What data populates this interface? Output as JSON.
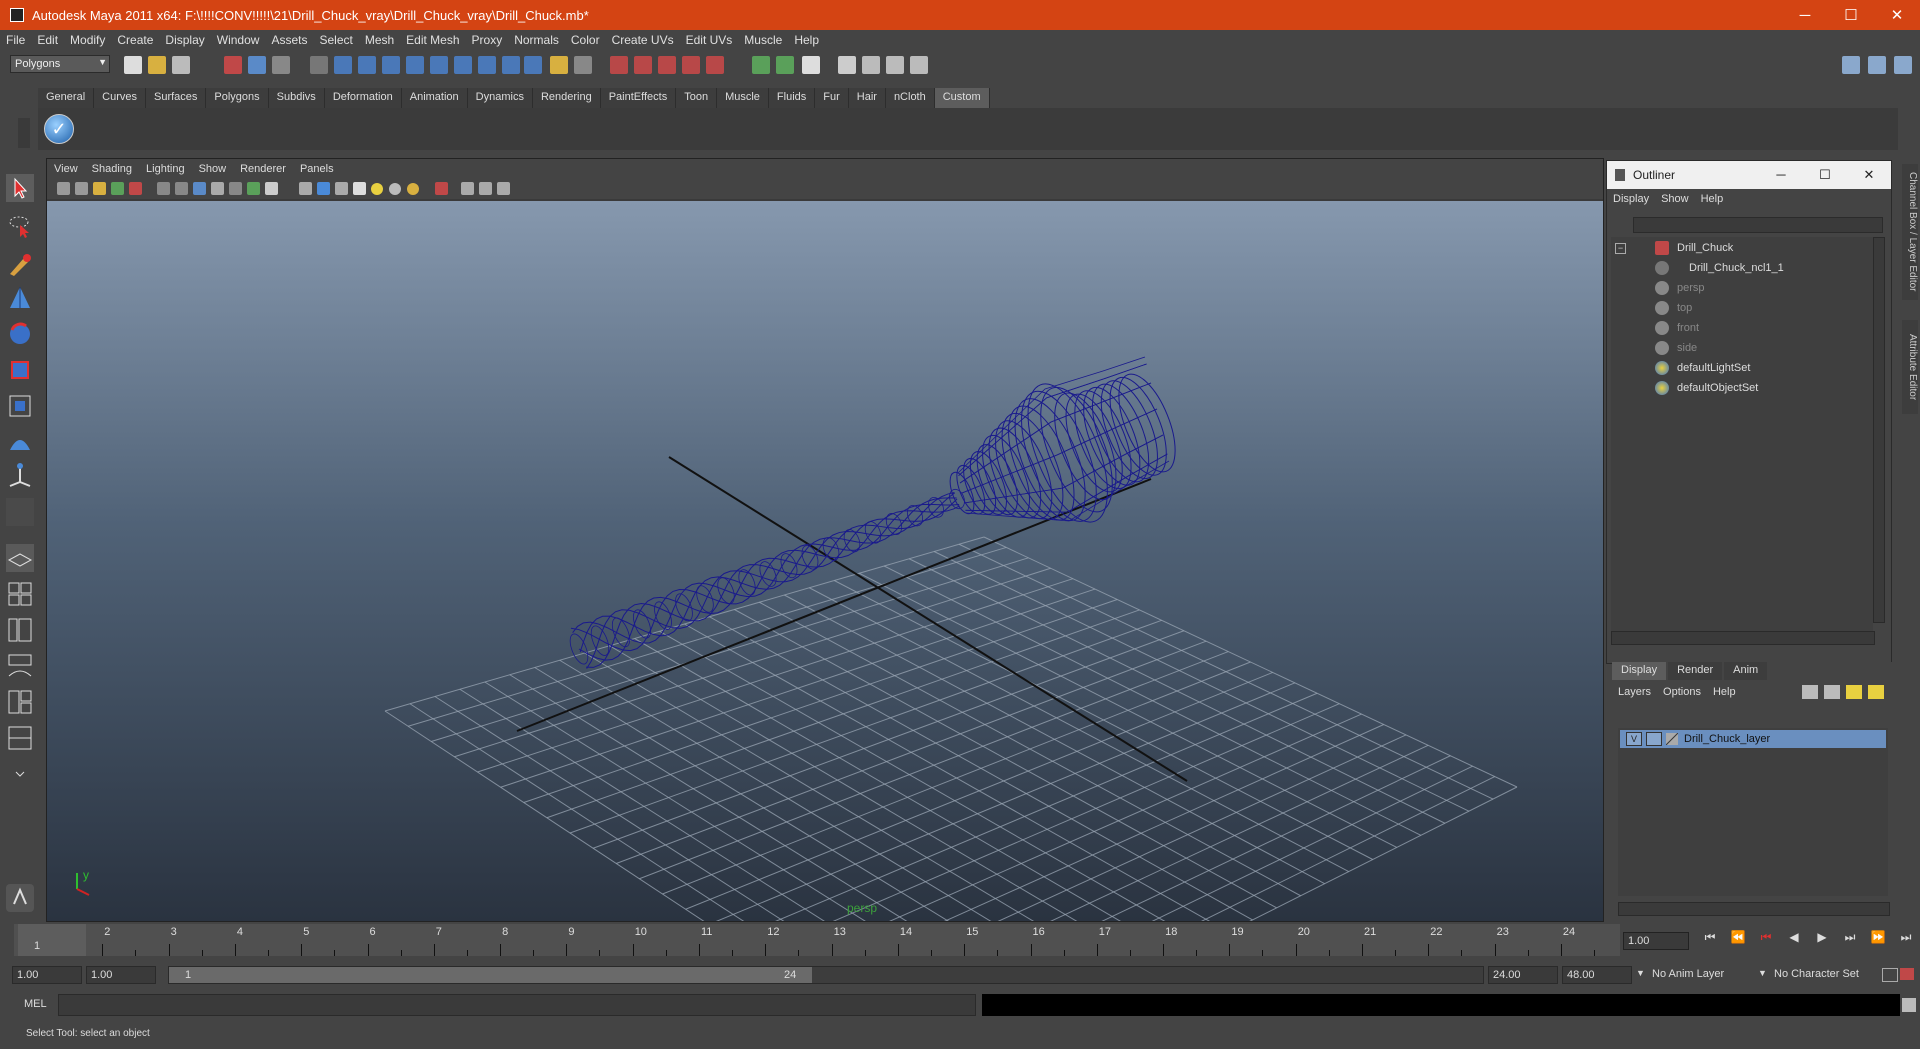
{
  "window": {
    "title": "Autodesk Maya 2011 x64: F:\\!!!!CONV!!!!!\\21\\Drill_Chuck_vray\\Drill_Chuck_vray\\Drill_Chuck.mb*",
    "minimize": "─",
    "maximize": "☐",
    "close": "✕"
  },
  "menubar": [
    "File",
    "Edit",
    "Modify",
    "Create",
    "Display",
    "Window",
    "Assets",
    "Select",
    "Mesh",
    "Edit Mesh",
    "Proxy",
    "Normals",
    "Color",
    "Create UVs",
    "Edit UVs",
    "Muscle",
    "Help"
  ],
  "statusline": {
    "menuset": "Polygons"
  },
  "shelf": {
    "tabs": [
      "General",
      "Curves",
      "Surfaces",
      "Polygons",
      "Subdivs",
      "Deformation",
      "Animation",
      "Dynamics",
      "Rendering",
      "PaintEffects",
      "Toon",
      "Muscle",
      "Fluids",
      "Fur",
      "Hair",
      "nCloth",
      "Custom"
    ],
    "active_tab": "Custom"
  },
  "viewport": {
    "menu": [
      "View",
      "Shading",
      "Lighting",
      "Show",
      "Renderer",
      "Panels"
    ],
    "camera_label": "persp",
    "axis_y": "y",
    "colors": {
      "wire": "#1a1a8c",
      "grid": "#9aa6b4",
      "axis": "#111111",
      "axis_y": "#2fbf2f",
      "axis_x": "#d22222"
    }
  },
  "outliner": {
    "title": "Outliner",
    "menu": [
      "Display",
      "Show",
      "Help"
    ],
    "items": [
      {
        "label": "Drill_Chuck",
        "dim": false
      },
      {
        "label": "Drill_Chuck_ncl1_1",
        "dim": false
      },
      {
        "label": "persp",
        "dim": true
      },
      {
        "label": "top",
        "dim": true
      },
      {
        "label": "front",
        "dim": true
      },
      {
        "label": "side",
        "dim": true
      },
      {
        "label": "defaultLightSet",
        "dim": false
      },
      {
        "label": "defaultObjectSet",
        "dim": false
      }
    ]
  },
  "sidetabs": [
    "Channel Box / Layer Editor",
    "Attribute Editor"
  ],
  "layer_editor": {
    "tabs": [
      "Display",
      "Render",
      "Anim"
    ],
    "active_tab": "Display",
    "menu": [
      "Layers",
      "Options",
      "Help"
    ],
    "layer": {
      "visible": "V",
      "name": "Drill_Chuck_layer"
    }
  },
  "timeline": {
    "frames": [
      1,
      2,
      3,
      4,
      5,
      6,
      7,
      8,
      9,
      10,
      11,
      12,
      13,
      14,
      15,
      16,
      17,
      18,
      19,
      20,
      21,
      22,
      23,
      24
    ],
    "current_frame_marker": "1",
    "current_frame": "1.00"
  },
  "range": {
    "start_time": "1.00",
    "playback_start": "1.00",
    "slider_start": "1",
    "slider_end": "24",
    "playback_end": "24.00",
    "end_time": "48.00",
    "anim_layer": "No Anim Layer",
    "character_set": "No Character Set"
  },
  "commandline": {
    "label": "MEL"
  },
  "helpline": {
    "text": "Select Tool: select an object"
  }
}
